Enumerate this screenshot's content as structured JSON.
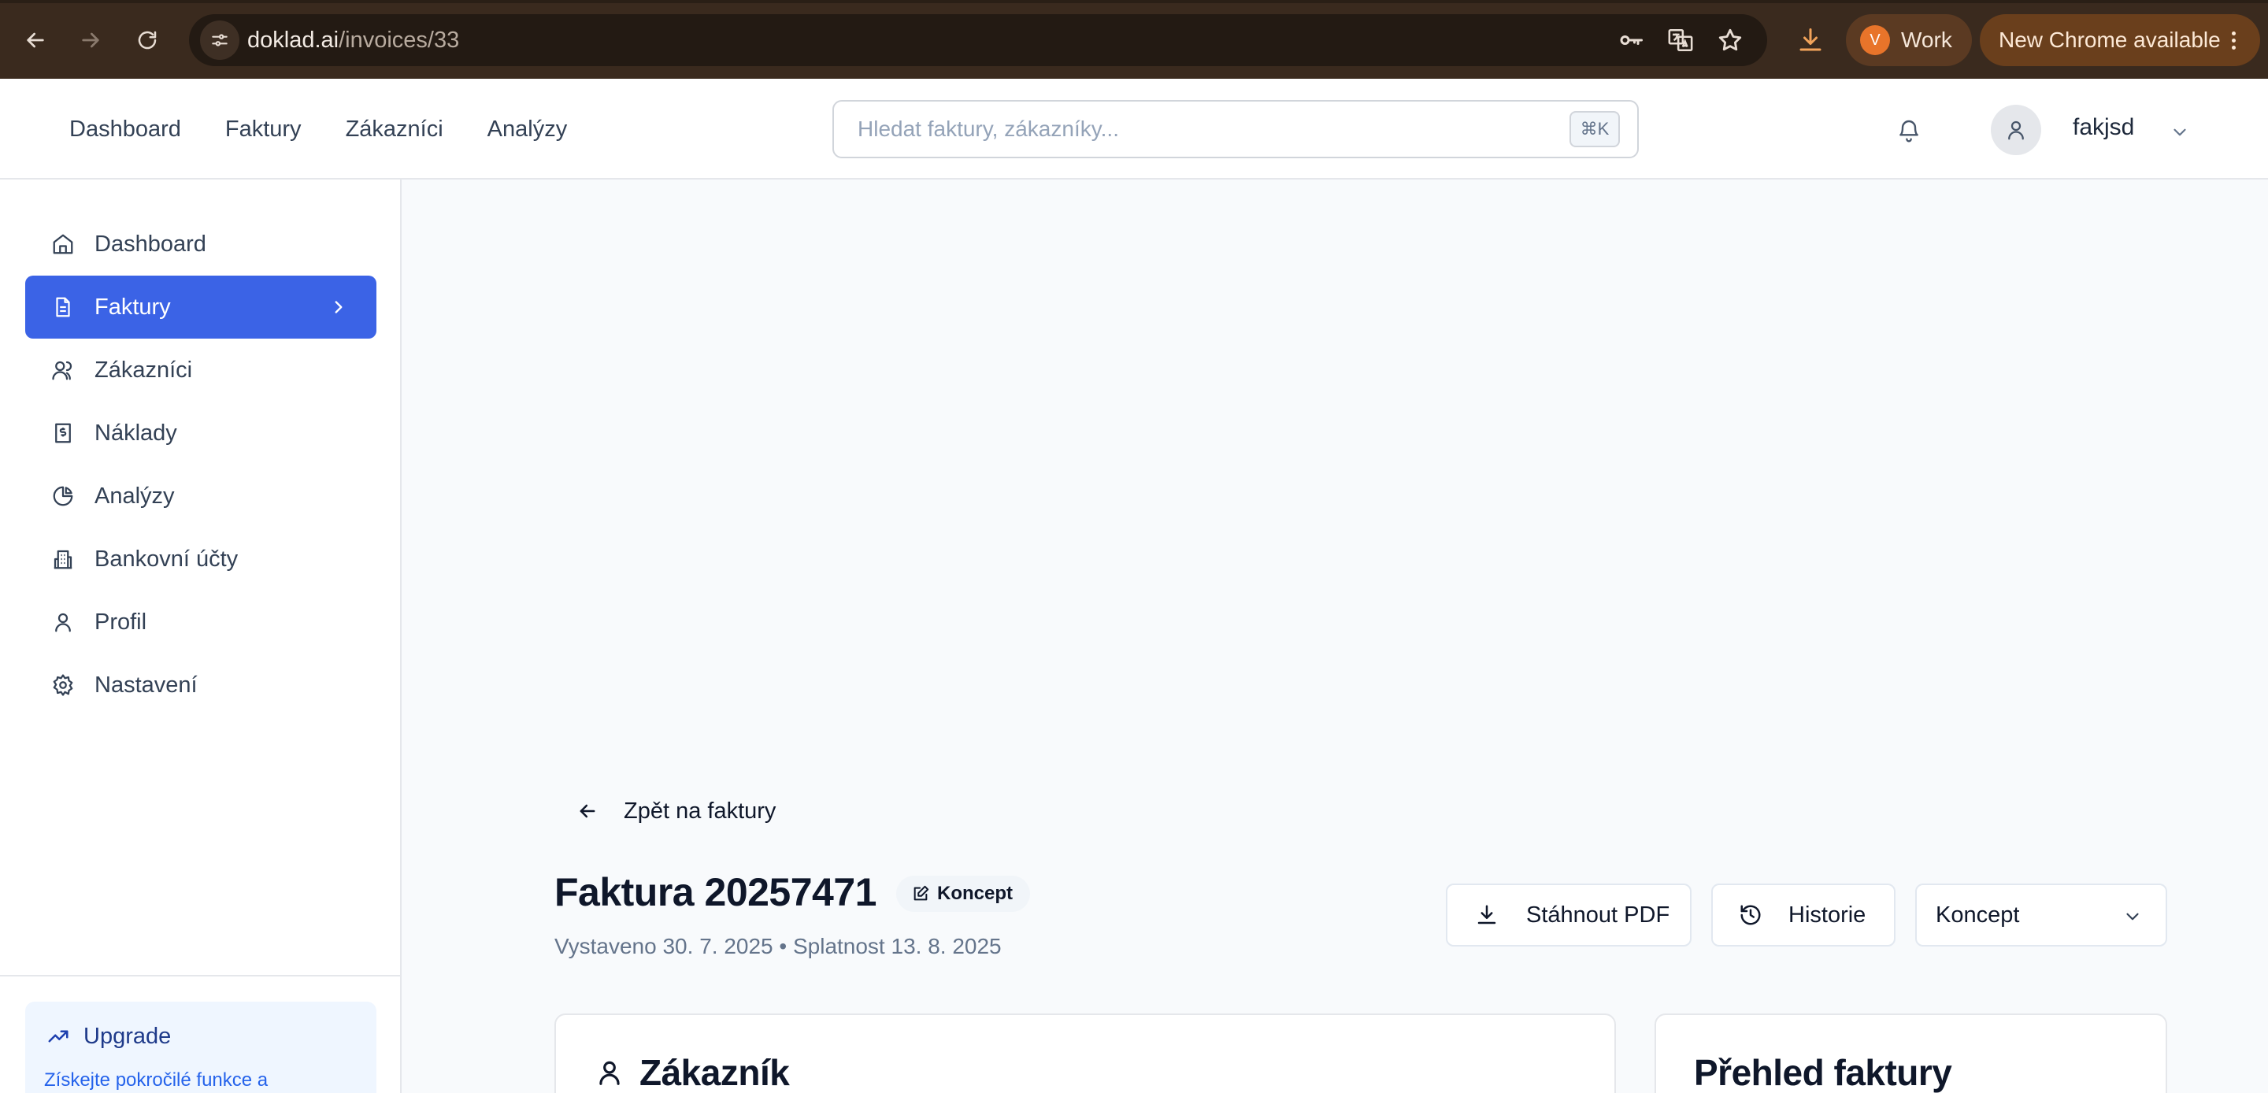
{
  "browser": {
    "url_host": "doklad.ai",
    "url_path": "/invoices/33",
    "profile_initial": "V",
    "profile_name": "Work",
    "update_label": "New Chrome available"
  },
  "header": {
    "nav": [
      "Dashboard",
      "Faktury",
      "Zákazníci",
      "Analýzy"
    ],
    "search_placeholder": "Hledat faktury, zákazníky...",
    "search_shortcut": "⌘K",
    "user_name": "fakjsd"
  },
  "sidebar": {
    "items": [
      {
        "label": "Dashboard",
        "icon": "home-icon"
      },
      {
        "label": "Faktury",
        "icon": "file-text-icon",
        "active": true
      },
      {
        "label": "Zákazníci",
        "icon": "users-icon"
      },
      {
        "label": "Náklady",
        "icon": "receipt-icon"
      },
      {
        "label": "Analýzy",
        "icon": "pie-chart-icon"
      },
      {
        "label": "Bankovní účty",
        "icon": "bank-icon"
      },
      {
        "label": "Profil",
        "icon": "user-icon"
      },
      {
        "label": "Nastavení",
        "icon": "gear-icon"
      }
    ],
    "upgrade_title": "Upgrade",
    "upgrade_text": "Získejte pokročilé funkce a"
  },
  "main": {
    "back_label": "Zpět na faktury",
    "invoice_title": "Faktura 20257471",
    "status_badge": "Koncept",
    "meta": "Vystaveno 30. 7. 2025 • Splatnost 13. 8. 2025",
    "download_label": "Stáhnout PDF",
    "history_label": "Historie",
    "status_value": "Koncept",
    "customer_heading": "Zákazník",
    "summary_heading": "Přehled faktury"
  },
  "colors": {
    "accent": "#3b63e6",
    "chrome_bg": "#3a2a1e"
  }
}
